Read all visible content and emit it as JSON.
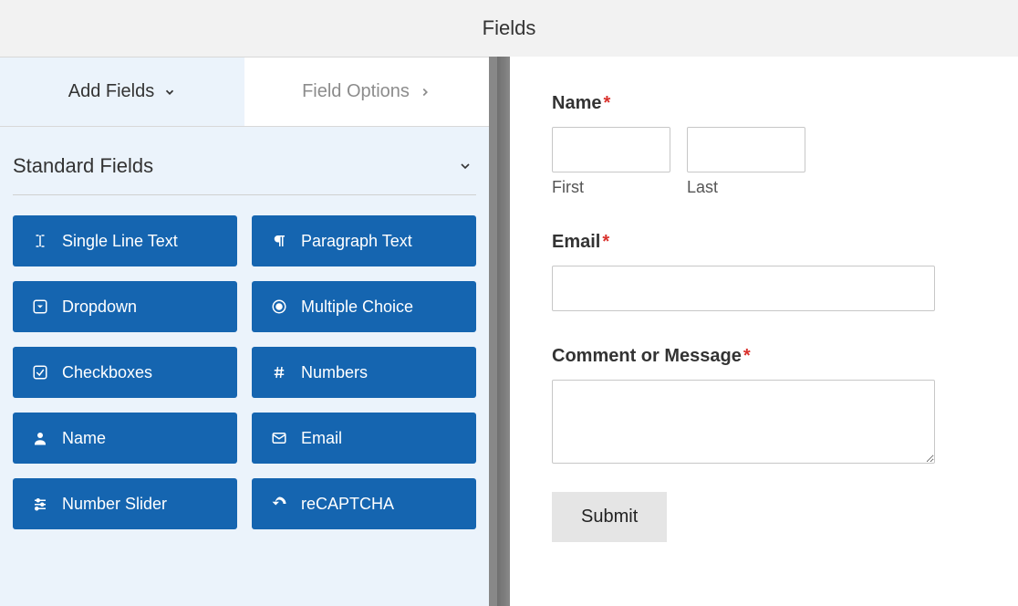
{
  "header": {
    "title": "Fields"
  },
  "tabs": {
    "add_fields": "Add Fields",
    "field_options": "Field Options"
  },
  "section": {
    "standard_fields": "Standard Fields"
  },
  "fields": {
    "single_line_text": "Single Line Text",
    "paragraph_text": "Paragraph Text",
    "dropdown": "Dropdown",
    "multiple_choice": "Multiple Choice",
    "checkboxes": "Checkboxes",
    "numbers": "Numbers",
    "name": "Name",
    "email": "Email",
    "number_slider": "Number Slider",
    "recaptcha": "reCAPTCHA"
  },
  "form": {
    "name_label": "Name",
    "first_label": "First",
    "last_label": "Last",
    "email_label": "Email",
    "comment_label": "Comment or Message",
    "submit_label": "Submit",
    "required_mark": "*"
  }
}
